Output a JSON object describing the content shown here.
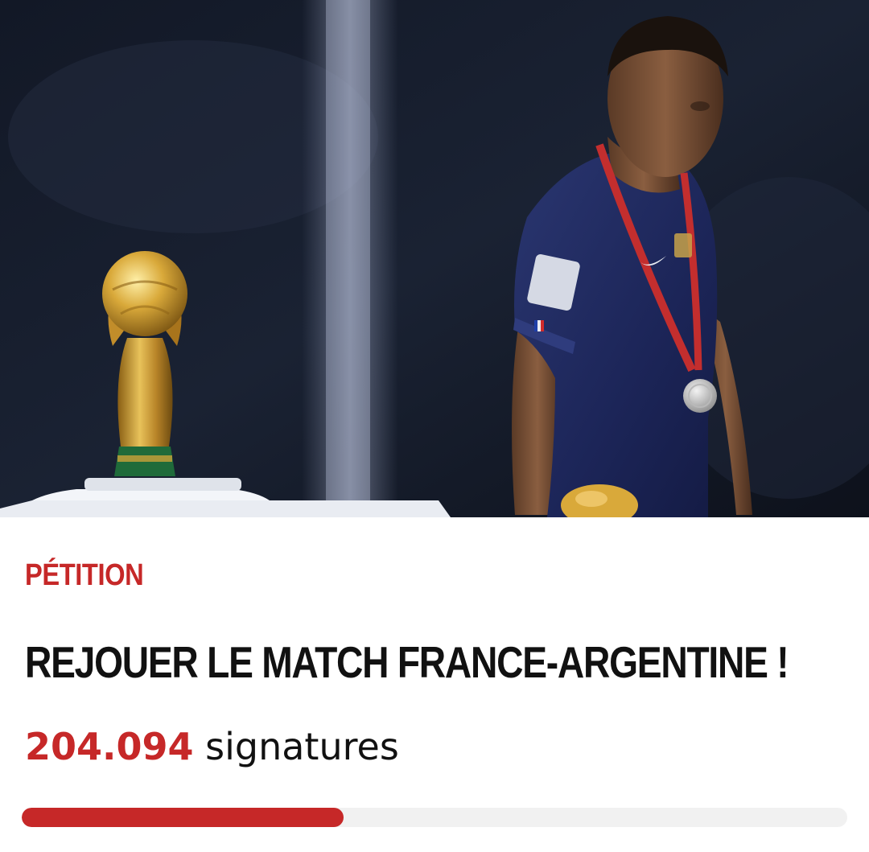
{
  "hero": {
    "image_alt": "Joueur de l'équipe de France passant devant le trophée de la Coupe du Monde"
  },
  "petition": {
    "label": "PÉTITION",
    "title": "REJOUER LE MATCH FRANCE-ARGENTINE !",
    "signature_count": "204.094",
    "signature_label": " signatures",
    "progress_fraction": 0.39
  },
  "colors": {
    "accent": "#c62828",
    "text": "#111111",
    "track": "#f1f1f1"
  }
}
